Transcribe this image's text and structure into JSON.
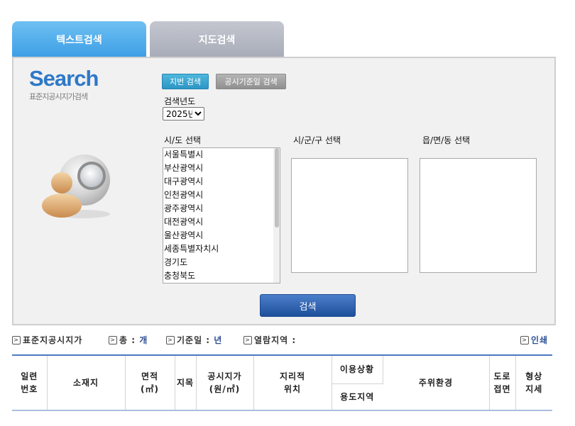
{
  "tabs": {
    "text_search": "텍스트검색",
    "map_search": "지도검색"
  },
  "logo": {
    "title": "Search",
    "subtitle": "표준지공시지가검색"
  },
  "buttons": {
    "jibun": "지번 검색",
    "date_search": "공시기준일 검색",
    "search": "검색"
  },
  "year": {
    "label": "검색년도",
    "selected": "2025년"
  },
  "labels": {
    "sido": "시/도 선택",
    "sigungu": "시/군/구 선택",
    "emd": "읍/면/동 선택"
  },
  "sido_list": [
    "서울특별시",
    "부산광역시",
    "대구광역시",
    "인천광역시",
    "광주광역시",
    "대전광역시",
    "울산광역시",
    "세종특별자치시",
    "경기도",
    "충청북도"
  ],
  "info_bar": {
    "standard_price": "표준지공시지가",
    "total_label": "총 :",
    "total_unit": "개",
    "base_date_label": "기준일 :",
    "base_date_unit": "년",
    "region_label": "열람지역 :",
    "print": "인쇄"
  },
  "table_headers": {
    "serial_1": "일련",
    "serial_2": "번호",
    "location": "소재지",
    "area_1": "면적",
    "area_2": "(㎡)",
    "land_category": "지목",
    "price_1": "공시지가",
    "price_2": "(원/㎡)",
    "geo_1": "지리적",
    "geo_2": "위치",
    "usage_status": "이용상황",
    "zoning": "용도지역",
    "surroundings": "주위환경",
    "road_1": "도로",
    "road_2": "접면",
    "shape_1": "형상",
    "shape_2": "지세"
  }
}
